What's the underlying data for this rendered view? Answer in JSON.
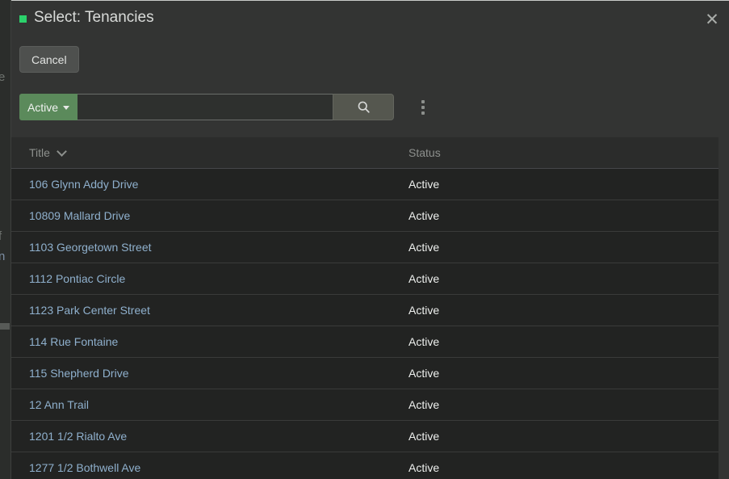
{
  "background": {
    "fragments": [
      "e",
      "f",
      "n"
    ]
  },
  "modal": {
    "title": "Select: Tenancies",
    "status_dot_color": "#2bd16b",
    "close_label": "✕",
    "cancel_label": "Cancel",
    "toolbar": {
      "filter_label": "Active",
      "filter_icon": "chevron-down-icon",
      "search_value": "",
      "search_placeholder": "",
      "search_button_icon": "search-icon",
      "overflow_icon": "kebab-menu-icon"
    },
    "table": {
      "columns": [
        {
          "label": "Title",
          "sort_icon": "chevron-down-icon"
        },
        {
          "label": "Status",
          "sort_icon": ""
        }
      ],
      "rows": [
        {
          "title": "106 Glynn Addy Drive",
          "status": "Active"
        },
        {
          "title": "10809 Mallard Drive",
          "status": "Active"
        },
        {
          "title": "1103 Georgetown Street",
          "status": "Active"
        },
        {
          "title": "1112 Pontiac Circle",
          "status": "Active"
        },
        {
          "title": "1123 Park Center Street",
          "status": "Active"
        },
        {
          "title": "114 Rue Fontaine",
          "status": "Active"
        },
        {
          "title": "115 Shepherd Drive",
          "status": "Active"
        },
        {
          "title": "12 Ann Trail",
          "status": "Active"
        },
        {
          "title": "1201 1/2 Rialto Ave",
          "status": "Active"
        },
        {
          "title": "1277 1/2 Bothwell Ave",
          "status": "Active"
        }
      ]
    }
  },
  "colors": {
    "accent_green": "#5b8a5b",
    "dot_green": "#2bd16b",
    "link_blue": "#8fb0cd",
    "modal_bg": "#333433",
    "table_bg": "#222322"
  }
}
